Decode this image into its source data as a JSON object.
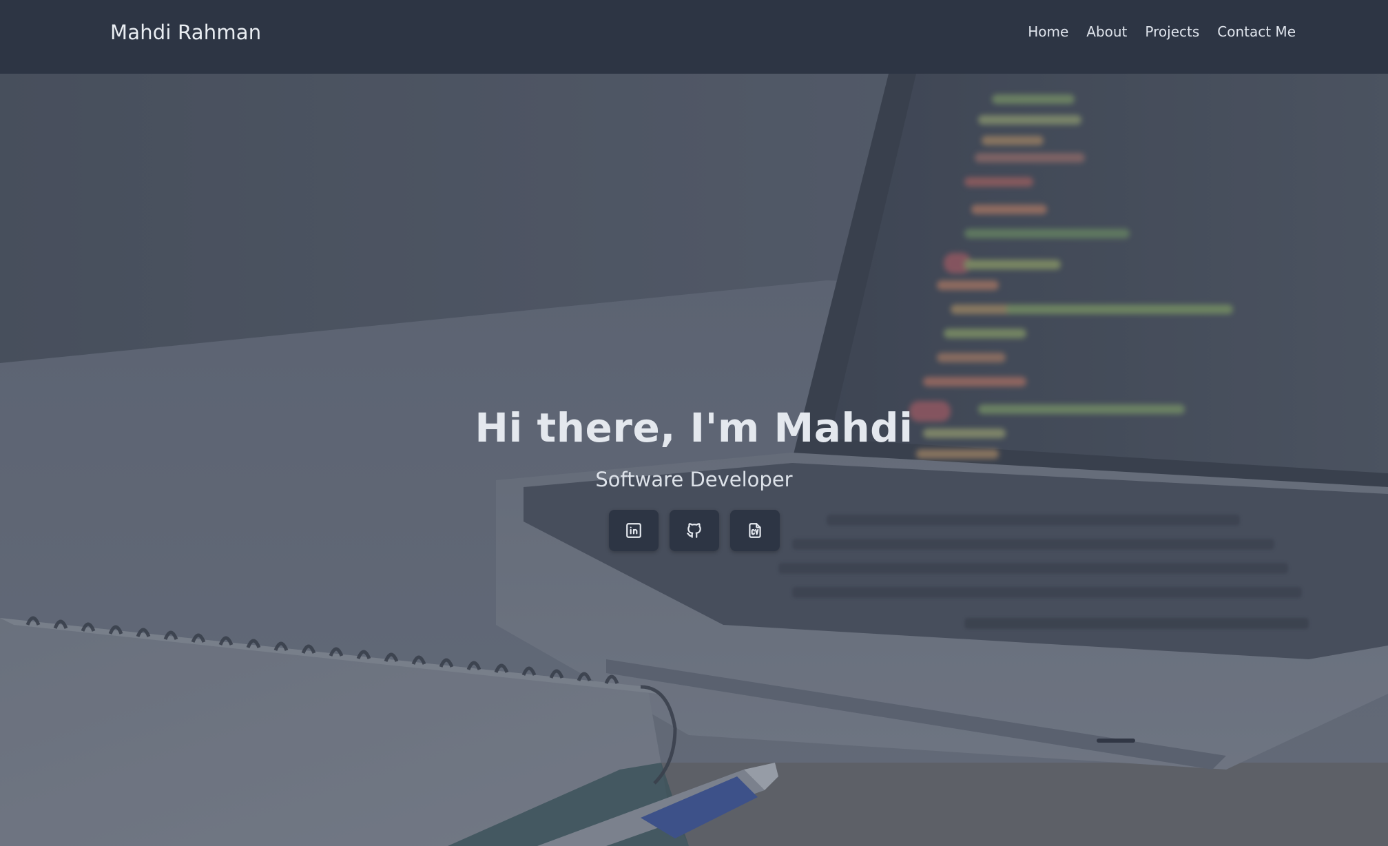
{
  "header": {
    "brand": "Mahdi Rahman",
    "nav": [
      {
        "label": "Home"
      },
      {
        "label": "About"
      },
      {
        "label": "Projects"
      },
      {
        "label": "Contact Me"
      }
    ]
  },
  "hero": {
    "title": "Hi there, I'm Mahdi",
    "subtitle": "Software Developer",
    "buttons": [
      {
        "icon": "linkedin-icon"
      },
      {
        "icon": "github-icon"
      },
      {
        "icon": "cv-document-icon"
      }
    ]
  },
  "colors": {
    "navbar": "#2d3544",
    "button": "#2d3544",
    "text_light": "#e4e8ee"
  }
}
